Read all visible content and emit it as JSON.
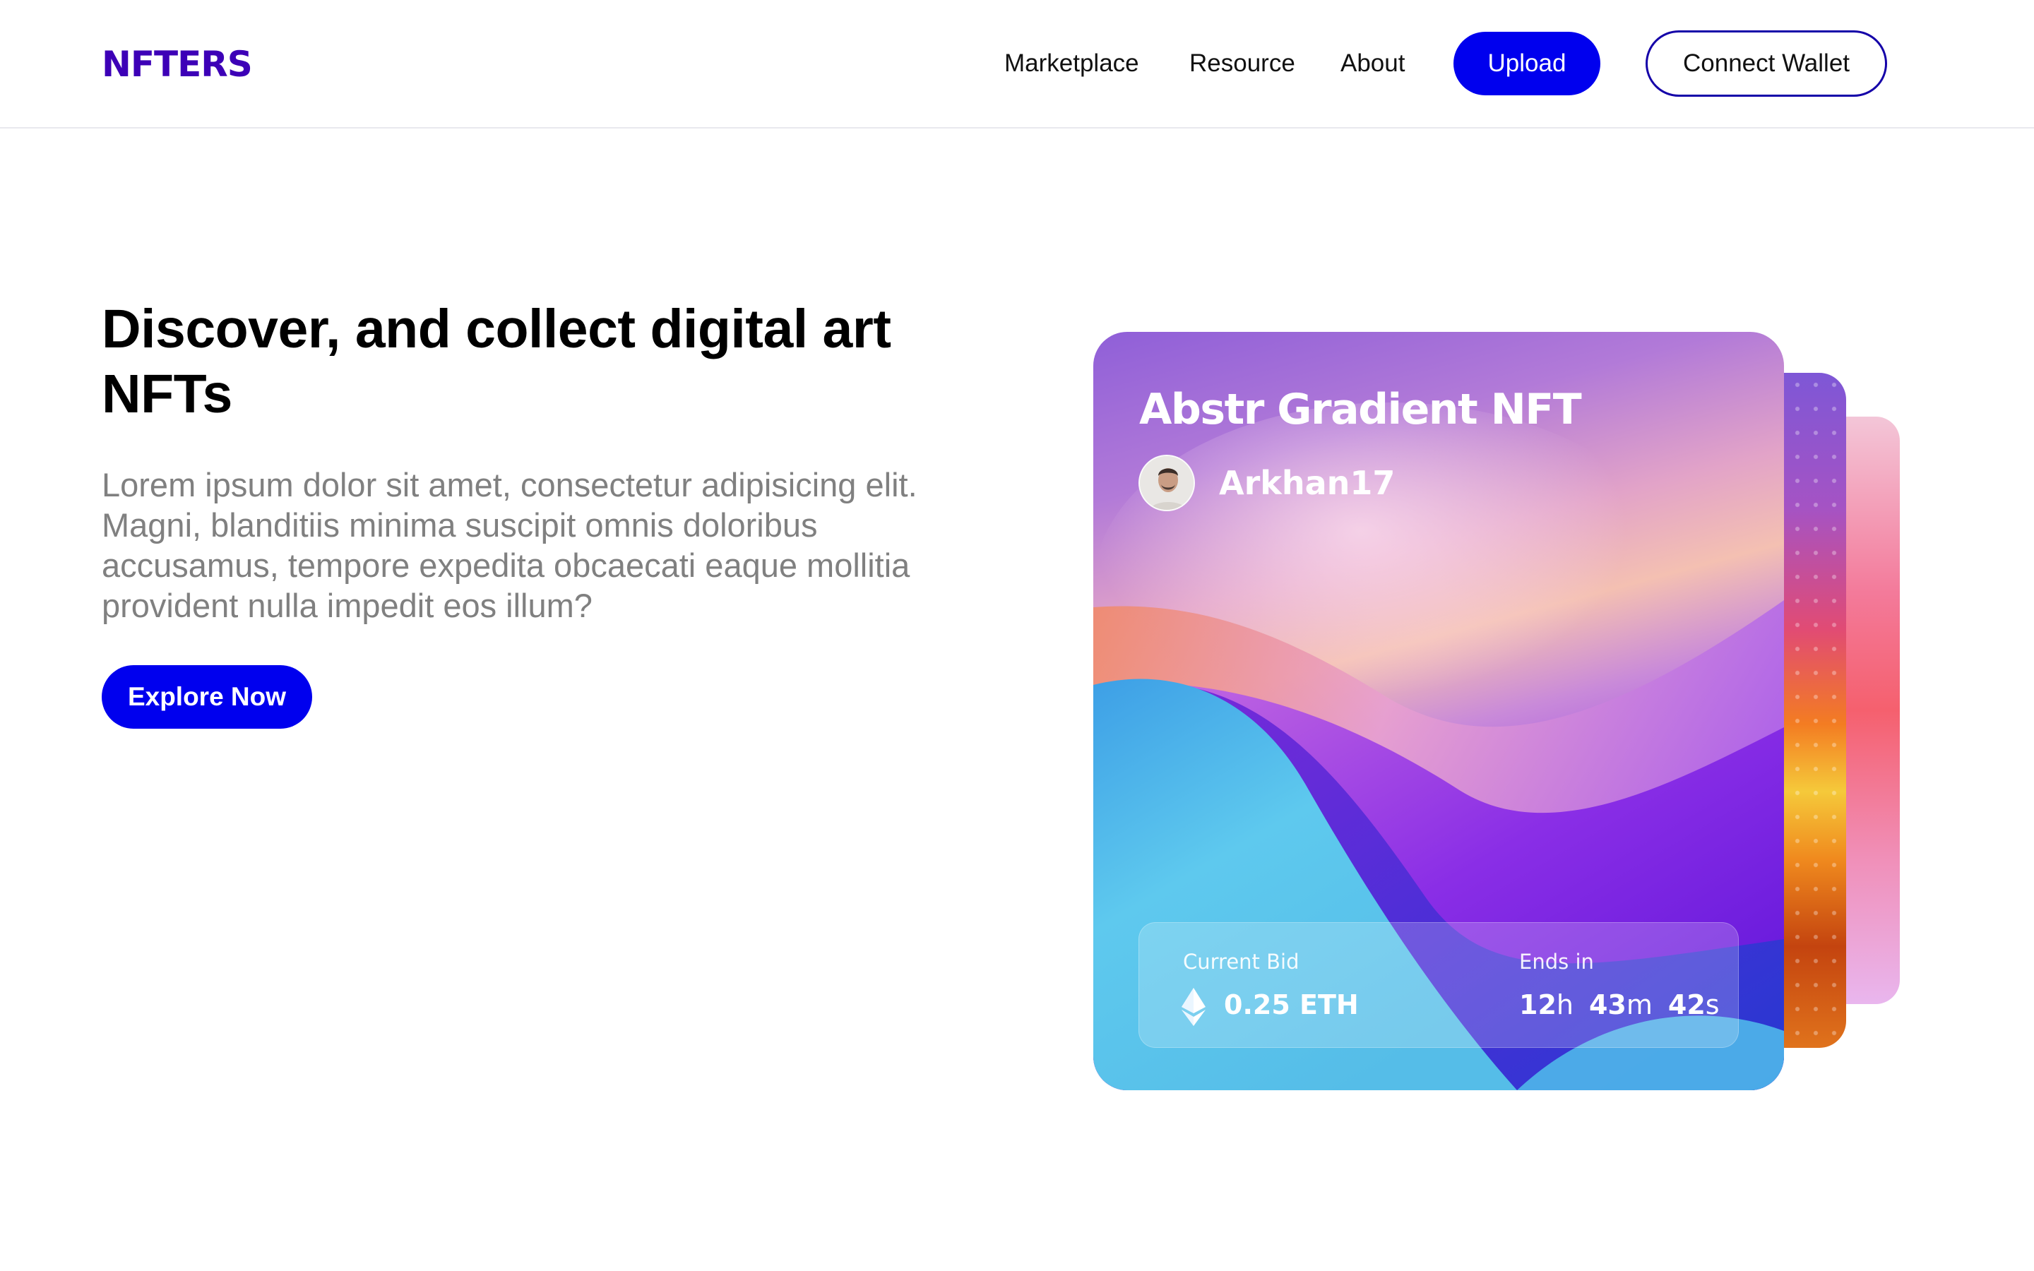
{
  "header": {
    "logo": "NFTERS",
    "nav": [
      "Marketplace",
      "Resource",
      "About"
    ],
    "upload_label": "Upload",
    "connect_wallet_label": "Connect Wallet"
  },
  "hero": {
    "title": "Discover, and collect digital art NFTs",
    "description": "Lorem ipsum dolor sit amet, consectetur adipisicing elit. Magni, blanditiis minima suscipit omnis doloribus accusamus, tempore expedita obcaecati eaque mollitia provident nulla impedit eos illum?",
    "cta_label": "Explore Now"
  },
  "nft_card": {
    "title": "Abstr Gradient NFT",
    "creator": "Arkhan17",
    "current_bid_label": "Current Bid",
    "current_bid_value": "0.25 ETH",
    "ends_in_label": "Ends in",
    "ends_in": {
      "hours": "12",
      "hours_unit": "h",
      "minutes": "43",
      "minutes_unit": "m",
      "seconds": "42",
      "seconds_unit": "s"
    },
    "currency_icon": "ethereum-icon"
  },
  "colors": {
    "brand": "#3d00b7",
    "primary_button": "#0000ee",
    "text_muted": "#808080"
  }
}
